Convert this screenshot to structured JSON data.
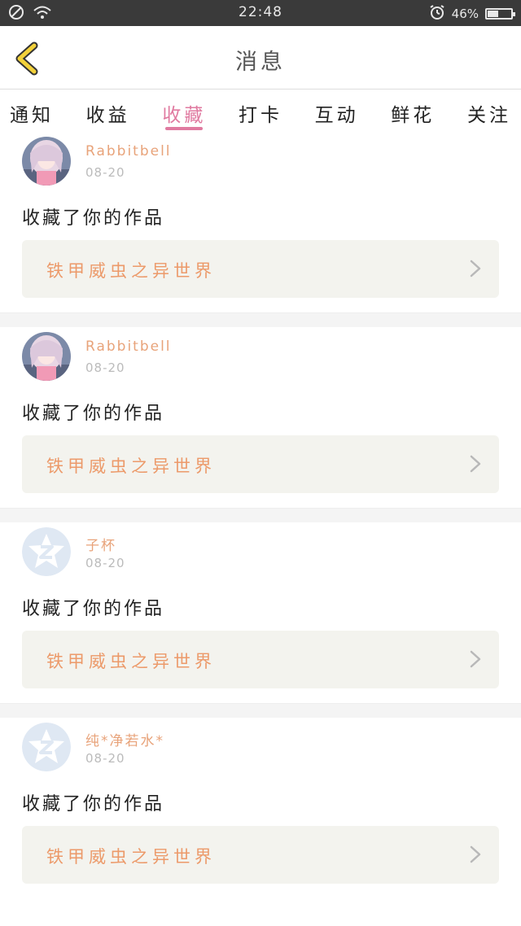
{
  "status_bar": {
    "time": "22:48",
    "battery_text": "46%",
    "battery_level_percent": 46,
    "icons": [
      "do-not-disturb-icon",
      "wifi-icon",
      "alarm-icon",
      "battery-icon"
    ]
  },
  "header": {
    "title": "消息",
    "back_icon": "chevron-left-icon",
    "back_color": "#f2d13a"
  },
  "tabs": [
    {
      "label": "通知",
      "active": false
    },
    {
      "label": "收益",
      "active": false
    },
    {
      "label": "收藏",
      "active": true
    },
    {
      "label": "打卡",
      "active": false
    },
    {
      "label": "互动",
      "active": false
    },
    {
      "label": "鲜花",
      "active": false
    },
    {
      "label": "关注",
      "active": false
    }
  ],
  "accent_color": "#e07aa0",
  "messages": [
    {
      "username": "Rabbitbell",
      "date": "08-20",
      "action": "收藏了你的作品",
      "work_title": "铁甲威虫之异世界",
      "avatar": "anime-girl-avatar"
    },
    {
      "username": "Rabbitbell",
      "date": "08-20",
      "action": "收藏了你的作品",
      "work_title": "铁甲威虫之异世界",
      "avatar": "anime-girl-avatar"
    },
    {
      "username": "子杯",
      "date": "08-20",
      "action": "收藏了你的作品",
      "work_title": "铁甲威虫之异世界",
      "avatar": "default-z-avatar"
    },
    {
      "username": "纯*净若水*",
      "date": "08-20",
      "action": "收藏了你的作品",
      "work_title": "铁甲威虫之异世界",
      "avatar": "default-z-avatar"
    }
  ]
}
